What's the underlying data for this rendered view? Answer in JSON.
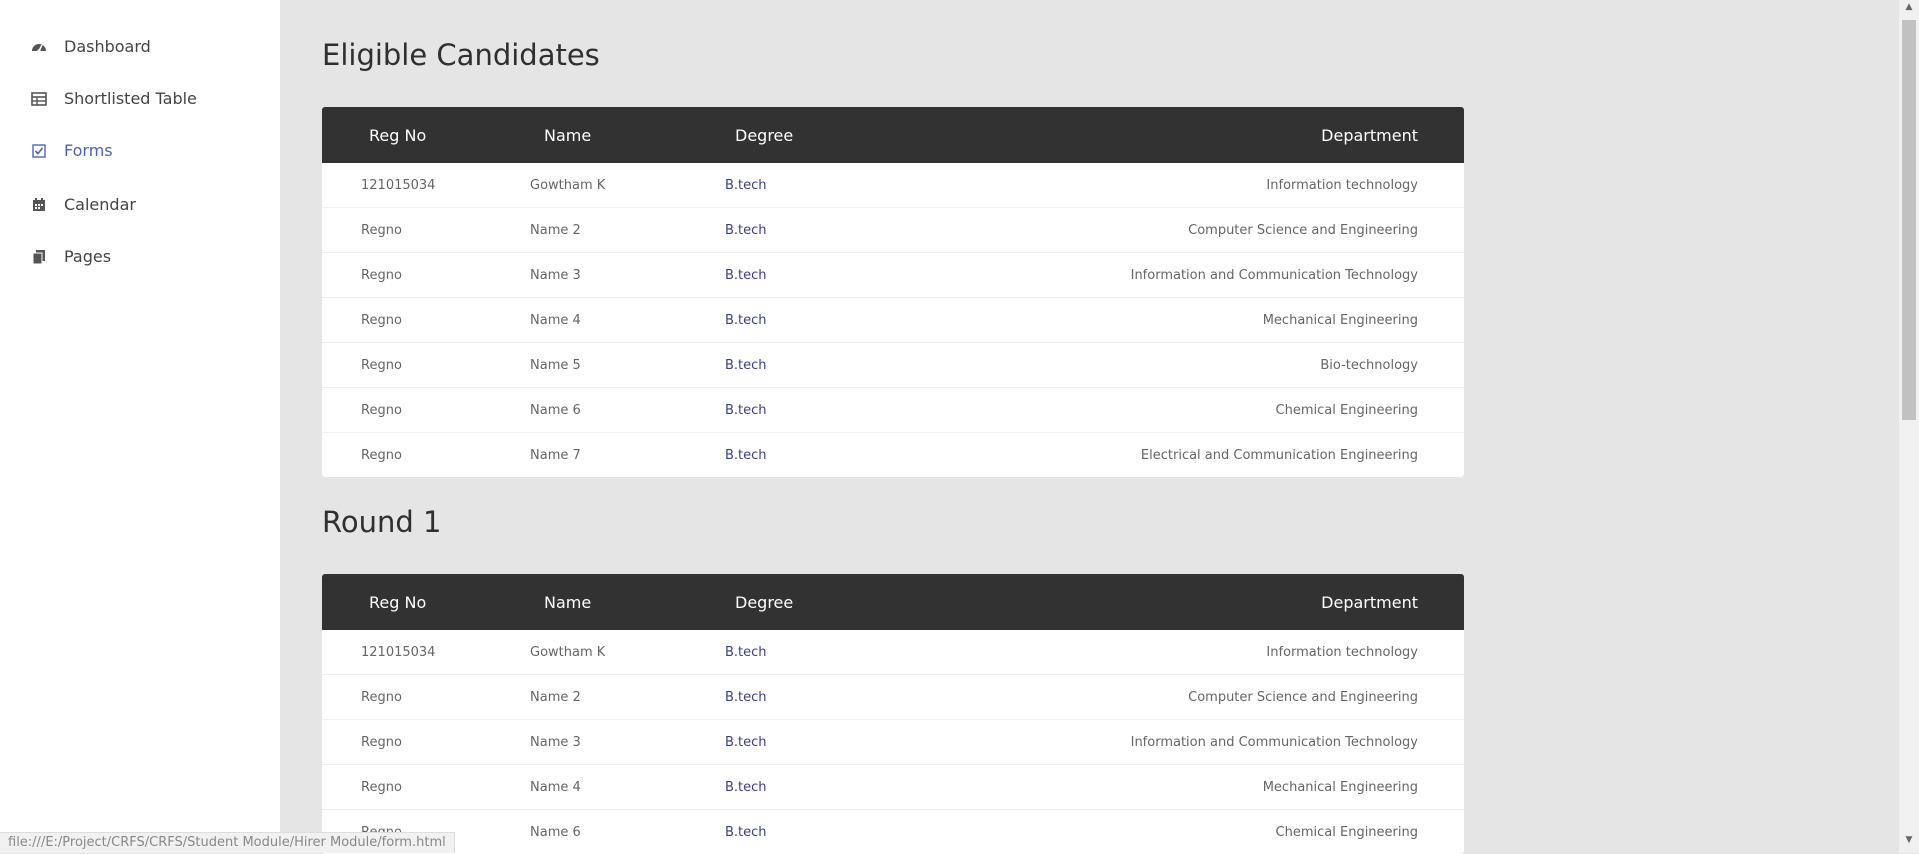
{
  "sidebar": {
    "items": [
      {
        "label": "Dashboard",
        "icon": "dashboard-icon"
      },
      {
        "label": "Shortlisted Table",
        "icon": "table-icon"
      },
      {
        "label": "Forms",
        "icon": "checkbox-icon",
        "active": true
      },
      {
        "label": "Calendar",
        "icon": "calendar-icon"
      },
      {
        "label": "Pages",
        "icon": "pages-icon"
      }
    ],
    "active_color": "#4c63b6"
  },
  "sections": [
    {
      "title": "Eligible Candidates",
      "headers": [
        "Reg No",
        "Name",
        "Degree",
        "Department"
      ],
      "rows": [
        [
          "121015034",
          "Gowtham K",
          "B.tech",
          "Information technology"
        ],
        [
          "Regno",
          "Name 2",
          "B.tech",
          "Computer Science and Engineering"
        ],
        [
          "Regno",
          "Name 3",
          "B.tech",
          "Information and Communication Technology"
        ],
        [
          "Regno",
          "Name 4",
          "B.tech",
          "Mechanical Engineering"
        ],
        [
          "Regno",
          "Name 5",
          "B.tech",
          "Bio-technology"
        ],
        [
          "Regno",
          "Name 6",
          "B.tech",
          "Chemical Engineering"
        ],
        [
          "Regno",
          "Name 7",
          "B.tech",
          "Electrical and Communication Engineering"
        ]
      ]
    },
    {
      "title": "Round 1",
      "headers": [
        "Reg No",
        "Name",
        "Degree",
        "Department"
      ],
      "rows": [
        [
          "121015034",
          "Gowtham K",
          "B.tech",
          "Information technology"
        ],
        [
          "Regno",
          "Name 2",
          "B.tech",
          "Computer Science and Engineering"
        ],
        [
          "Regno",
          "Name 3",
          "B.tech",
          "Information and Communication Technology"
        ],
        [
          "Regno",
          "Name 4",
          "B.tech",
          "Mechanical Engineering"
        ],
        [
          "Regno",
          "Name 6",
          "B.tech",
          "Chemical Engineering"
        ]
      ]
    }
  ],
  "status_bar": {
    "url": "file:///E:/Project/CRFS/CRFS/Student Module/Hirer Module/form.html"
  }
}
